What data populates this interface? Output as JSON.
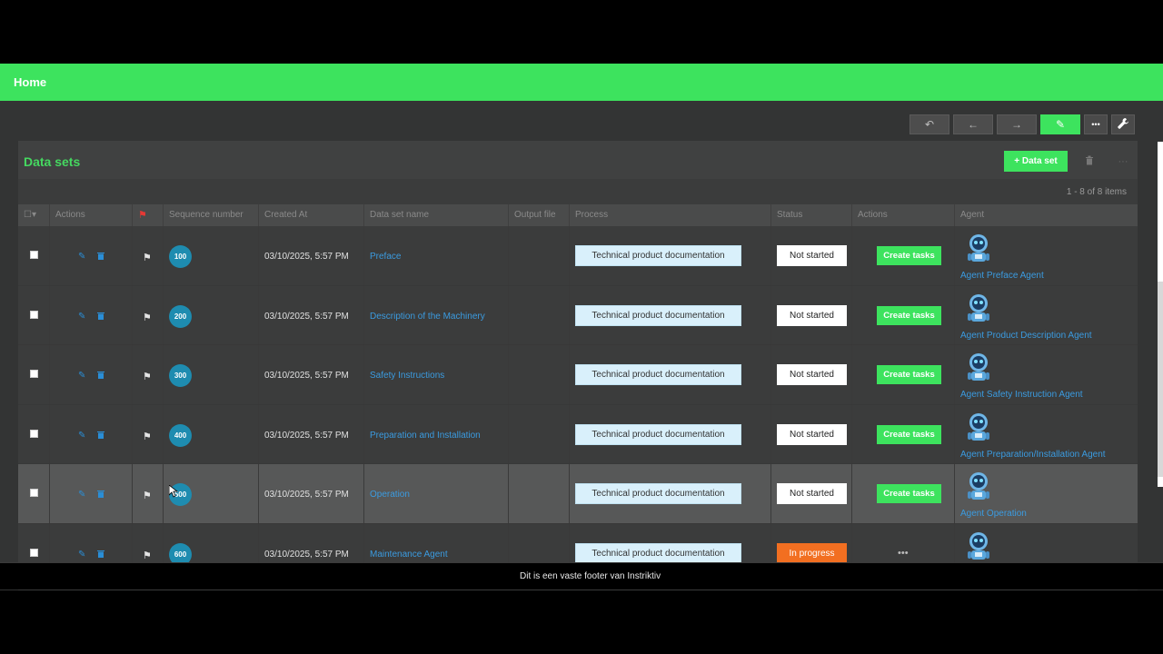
{
  "header": {
    "title": "Home"
  },
  "toolbar": {
    "buttons": [
      {
        "name": "undo",
        "icon": "↶"
      },
      {
        "name": "back",
        "icon": "←"
      },
      {
        "name": "forward",
        "icon": "→"
      },
      {
        "name": "edit",
        "icon": "✎"
      },
      {
        "name": "more",
        "icon": "•••"
      },
      {
        "name": "settings",
        "icon": "🔧"
      }
    ]
  },
  "panel": {
    "title": "Data sets",
    "add_button": "+ Data set",
    "pager": "1 - 8 of 8 items"
  },
  "columns": [
    "",
    "Actions",
    "",
    "Sequence number",
    "Created At",
    "Data set name",
    "Output file",
    "Process",
    "Status",
    "Actions",
    "Agent"
  ],
  "rows": [
    {
      "seq": "100",
      "created": "03/10/2025, 5:57 PM",
      "name": "Preface",
      "process": "Technical product documentation",
      "status": "Not started",
      "action": "Create tasks",
      "agent": "Agent Preface Agent"
    },
    {
      "seq": "200",
      "created": "03/10/2025, 5:57 PM",
      "name": "Description of the Machinery",
      "process": "Technical product documentation",
      "status": "Not started",
      "action": "Create tasks",
      "agent": "Agent Product Description Agent"
    },
    {
      "seq": "300",
      "created": "03/10/2025, 5:57 PM",
      "name": "Safety Instructions",
      "process": "Technical product documentation",
      "status": "Not started",
      "action": "Create tasks",
      "agent": "Agent Safety Instruction Agent"
    },
    {
      "seq": "400",
      "created": "03/10/2025, 5:57 PM",
      "name": "Preparation and Installation",
      "process": "Technical product documentation",
      "status": "Not started",
      "action": "Create tasks",
      "agent": "Agent Preparation/Installation Agent"
    },
    {
      "seq": "500",
      "created": "03/10/2025, 5:57 PM",
      "name": "Operation",
      "process": "Technical product documentation",
      "status": "Not started",
      "action": "Create tasks",
      "agent": "Agent Operation"
    },
    {
      "seq": "600",
      "created": "03/10/2025, 5:57 PM",
      "name": "Maintenance Agent",
      "process": "Technical product documentation",
      "status": "In progress",
      "action": "•••",
      "agent": ""
    }
  ],
  "footer": {
    "text": "Dit is een vaste footer van Instriktiv"
  },
  "colors": {
    "accent": "#3de35e",
    "link": "#3b9be0",
    "seq_badge": "#1e8cb0",
    "in_progress": "#f26f21"
  }
}
